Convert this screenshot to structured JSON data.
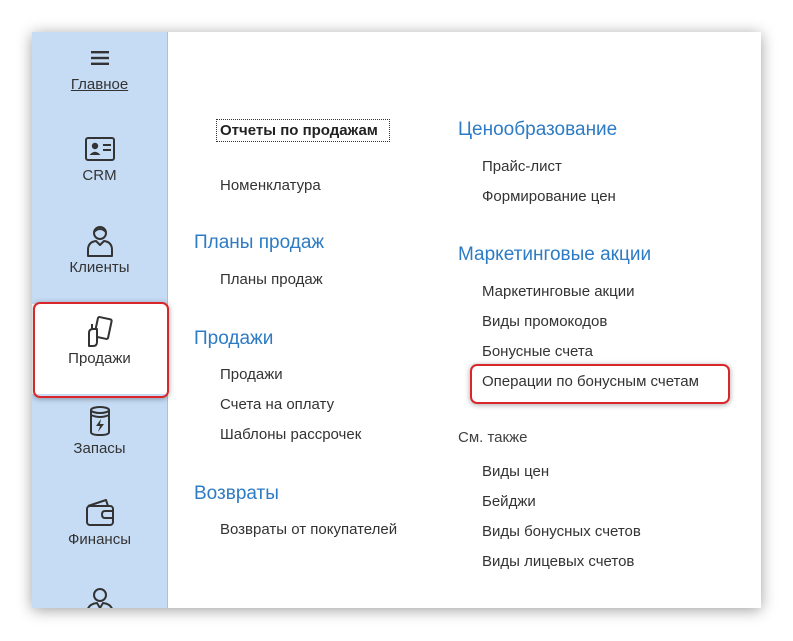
{
  "sidebar": {
    "items": [
      {
        "label": "Главное",
        "icon": "hamburger-menu-icon"
      },
      {
        "label": "CRM",
        "icon": "id-card-icon"
      },
      {
        "label": "Клиенты",
        "icon": "customer-person-icon"
      },
      {
        "label": "Продажи",
        "icon": "hand-card-icon"
      },
      {
        "label": "Запасы",
        "icon": "stock-jar-icon"
      },
      {
        "label": "Финансы",
        "icon": "wallet-icon"
      },
      {
        "label": "",
        "icon": "staff-person-icon"
      }
    ]
  },
  "left_column": {
    "top_links": [
      "Отчеты по продажам",
      "Номенклатура"
    ],
    "groups": [
      {
        "title": "Планы продаж",
        "links": [
          "Планы продаж"
        ]
      },
      {
        "title": "Продажи",
        "links": [
          "Продажи",
          "Счета на оплату",
          "Шаблоны рассрочек"
        ]
      },
      {
        "title": "Возвраты",
        "links": [
          "Возвраты от покупателей"
        ]
      }
    ]
  },
  "right_column": {
    "groups": [
      {
        "title": "Ценообразование",
        "links": [
          "Прайс-лист",
          "Формирование цен"
        ]
      },
      {
        "title": "Маркетинговые акции",
        "links": [
          "Маркетинговые акции",
          "Виды промокодов",
          "Бонусные счета",
          "Операции по бонусным счетам"
        ]
      }
    ],
    "see_also": {
      "title": "См. также",
      "links": [
        "Виды цен",
        "Бейджи",
        "Виды бонусных счетов",
        "Виды лицевых счетов"
      ]
    }
  },
  "colors": {
    "sidebar_bg": "#c6dcf5",
    "group_title": "#2d7bc4",
    "highlight": "#d9262b"
  }
}
